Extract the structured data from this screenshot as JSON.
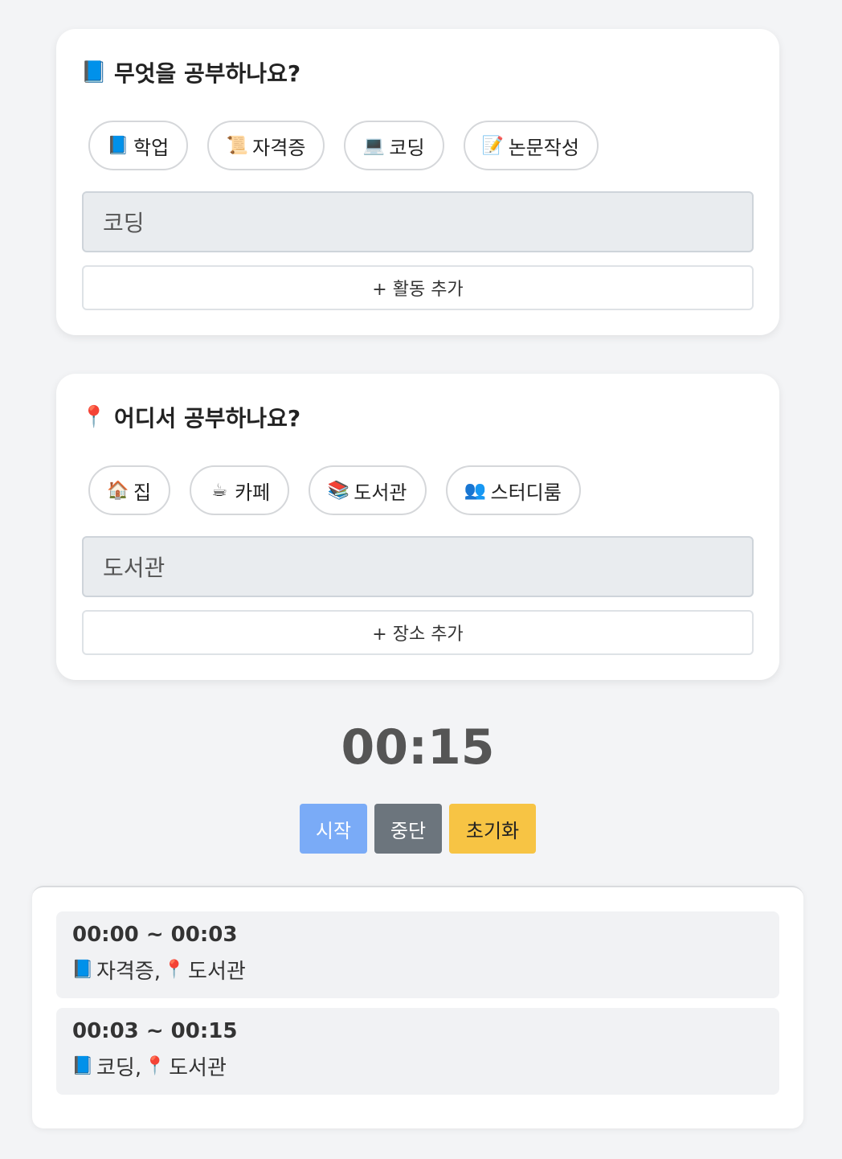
{
  "activity_card": {
    "title_icon": "📘",
    "title": "무엇을 공부하나요?",
    "chips": [
      {
        "icon": "📘",
        "label": "학업"
      },
      {
        "icon": "📜",
        "label": "자격증"
      },
      {
        "icon": "💻",
        "label": "코딩"
      },
      {
        "icon": "📝",
        "label": "논문작성"
      }
    ],
    "selected_value": "코딩",
    "add_button_label": "+ 활동 추가"
  },
  "place_card": {
    "title_icon": "📍",
    "title": "어디서 공부하나요?",
    "chips": [
      {
        "icon": "🏠",
        "label": "집"
      },
      {
        "icon": "☕",
        "label": "카페"
      },
      {
        "icon": "📚",
        "label": "도서관"
      },
      {
        "icon": "👥",
        "label": "스터디룸"
      }
    ],
    "selected_value": "도서관",
    "add_button_label": "+ 장소 추가"
  },
  "timer": {
    "display": "00:15",
    "start_label": "시작",
    "stop_label": "중단",
    "reset_label": "초기화",
    "colors": {
      "start": "#7aabf7",
      "stop": "#6c757d",
      "reset": "#f7c444"
    }
  },
  "log": {
    "entries": [
      {
        "time": "00:00 ~ 00:03",
        "activity_icon": "📘",
        "activity": "자격증,",
        "place_icon": "📍",
        "place": "도서관"
      },
      {
        "time": "00:03 ~ 00:15",
        "activity_icon": "📘",
        "activity": "코딩,",
        "place_icon": "📍",
        "place": "도서관"
      }
    ]
  }
}
